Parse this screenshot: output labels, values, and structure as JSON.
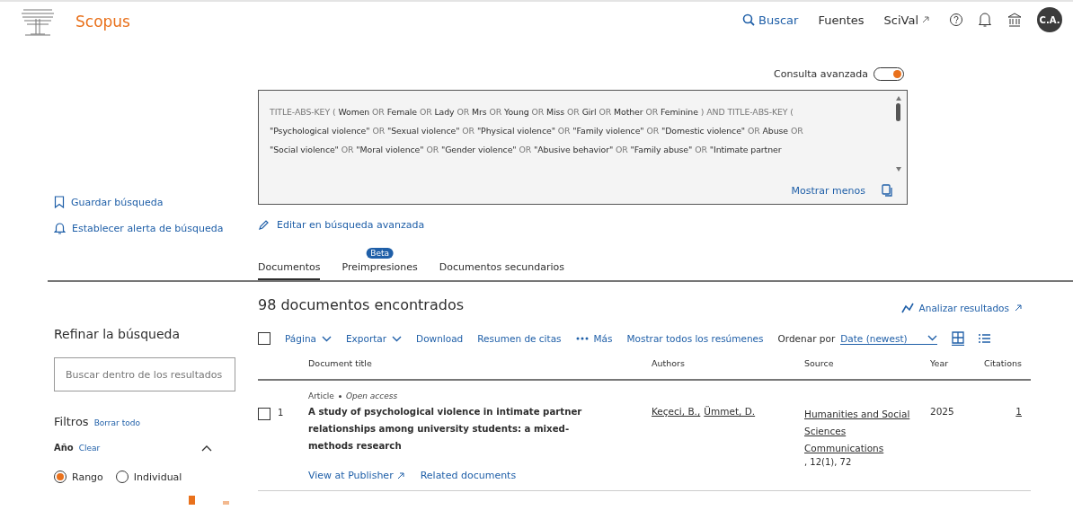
{
  "header": {
    "brand": "Scopus",
    "nav": [
      {
        "label": "Buscar",
        "kind": "search"
      },
      {
        "label": "Fuentes",
        "kind": "plain"
      },
      {
        "label": "SciVal",
        "kind": "external"
      }
    ],
    "avatar": "C.A."
  },
  "advanced_toggle": {
    "label": "Consulta avanzada",
    "on": true
  },
  "query": {
    "lines": [
      [
        {
          "text": "TITLE-ABS-KEY (",
          "kind": "op"
        },
        {
          "text": "Women",
          "kind": "term"
        },
        {
          "text": "OR",
          "kind": "op"
        },
        {
          "text": "Female",
          "kind": "term"
        },
        {
          "text": "OR",
          "kind": "op"
        },
        {
          "text": "Lady",
          "kind": "term"
        },
        {
          "text": "OR",
          "kind": "op"
        },
        {
          "text": "Mrs",
          "kind": "term"
        },
        {
          "text": "OR",
          "kind": "op"
        },
        {
          "text": "Young",
          "kind": "term"
        },
        {
          "text": "OR",
          "kind": "op"
        },
        {
          "text": "Miss",
          "kind": "term"
        },
        {
          "text": "OR",
          "kind": "op"
        },
        {
          "text": "Girl",
          "kind": "term"
        },
        {
          "text": "OR",
          "kind": "op"
        },
        {
          "text": "Mother",
          "kind": "term"
        },
        {
          "text": "OR",
          "kind": "op"
        },
        {
          "text": "Feminine",
          "kind": "term"
        },
        {
          "text": ") AND TITLE-ABS-KEY (",
          "kind": "op"
        }
      ],
      [
        {
          "text": "\"Psychological violence\"",
          "kind": "term"
        },
        {
          "text": "OR",
          "kind": "op"
        },
        {
          "text": "\"Sexual violence\"",
          "kind": "term"
        },
        {
          "text": "OR",
          "kind": "op"
        },
        {
          "text": "\"Physical violence\"",
          "kind": "term"
        },
        {
          "text": "OR",
          "kind": "op"
        },
        {
          "text": "\"Family violence\"",
          "kind": "term"
        },
        {
          "text": "OR",
          "kind": "op"
        },
        {
          "text": "\"Domestic violence\"",
          "kind": "term"
        },
        {
          "text": "OR",
          "kind": "op"
        },
        {
          "text": "Abuse",
          "kind": "term"
        },
        {
          "text": "OR",
          "kind": "op"
        }
      ],
      [
        {
          "text": "\"Social violence\"",
          "kind": "term"
        },
        {
          "text": "OR",
          "kind": "op"
        },
        {
          "text": "\"Moral violence\"",
          "kind": "term"
        },
        {
          "text": "OR",
          "kind": "op"
        },
        {
          "text": "\"Gender violence\"",
          "kind": "term"
        },
        {
          "text": "OR",
          "kind": "op"
        },
        {
          "text": "\"Abusive behavior\"",
          "kind": "term"
        },
        {
          "text": "OR",
          "kind": "op"
        },
        {
          "text": "\"Family abuse\"",
          "kind": "term"
        },
        {
          "text": "OR",
          "kind": "op"
        },
        {
          "text": "\"Intimate partner",
          "kind": "term"
        }
      ]
    ],
    "show_less": "Mostrar menos"
  },
  "side_links": [
    {
      "label": "Guardar búsqueda",
      "kind": "bookmark"
    },
    {
      "label": "Establecer alerta de búsqueda",
      "kind": "bell"
    }
  ],
  "edit_link": "Editar en búsqueda avanzada",
  "tabs": [
    {
      "label": "Documentos",
      "selected": true
    },
    {
      "label": "Preimpresiones",
      "selected": false,
      "badge": "Beta"
    },
    {
      "label": "Documentos secundarios",
      "selected": false
    }
  ],
  "refine": {
    "title": "Refinar la búsqueda",
    "search_placeholder": "Buscar dentro de los resultados",
    "filters_title": "Filtros",
    "clear_all": "Borrar todo",
    "year_label": "Año",
    "year_clear": "Clear",
    "year_expanded": true,
    "modes": [
      {
        "label": "Rango",
        "selected": true
      },
      {
        "label": "Individual",
        "selected": false
      }
    ]
  },
  "results": {
    "count": "98 documentos encontrados",
    "analyze": "Analizar resultados",
    "toolbar": [
      {
        "label": "Página",
        "kind": "dropdown"
      },
      {
        "label": "Exportar",
        "kind": "dropdown"
      },
      {
        "label": "Download",
        "kind": "plain"
      },
      {
        "label": "Resumen de citas",
        "kind": "plain"
      },
      {
        "label": "Más",
        "kind": "more"
      },
      {
        "label": "Mostrar todos los resúmenes",
        "kind": "plain"
      }
    ],
    "select_all_checked": false,
    "sort_label": "Ordenar por",
    "sort_value": "Date (newest)",
    "view_grid_selected": true,
    "columns": [
      "Document title",
      "Authors",
      "Source",
      "Year",
      "Citations"
    ],
    "rows": [
      {
        "checked": false,
        "number": "1",
        "type": "Article",
        "access": "Open access",
        "title": "A study of psychological violence in intimate partner relationships among university students: a mixed-methods research",
        "authors": [
          "Keçeci, B.,",
          "Ümmet, D."
        ],
        "source": "Humanities and Social Sciences Communications",
        "source_detail": ", 12(1), 72",
        "year": "2025",
        "citations": "1",
        "links": [
          "View at Publisher",
          "Related documents"
        ]
      }
    ]
  }
}
